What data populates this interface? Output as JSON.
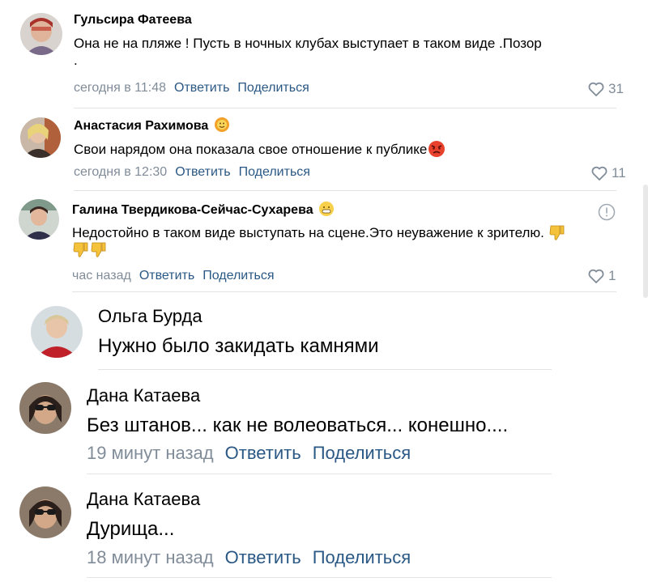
{
  "comments": [
    {
      "author": "Гульсира Фатеева",
      "text": "Она не на пляже ! Пусть в ночных клубах выступает в таком виде .Позор",
      "text_tail": ".",
      "time": "сегодня в 11:48",
      "reply": "Ответить",
      "share": "Поделиться",
      "likes": "31",
      "avatar_icon": "user-photo"
    },
    {
      "author": "Анастасия Рахимова",
      "author_badge": "smiley-icon",
      "text": "Свои нарядом она показала свое отношение к публике",
      "text_emoji": "angry-face",
      "time": "сегодня в 12:30",
      "reply": "Ответить",
      "share": "Поделиться",
      "likes": "11",
      "avatar_icon": "user-photo"
    },
    {
      "author": "Галина Твердикова-Сейчас-Сухарева",
      "author_badge": "grimace-face",
      "text": "Недостойно в таком виде выступать на сцене.Это неуважение к зрителю.",
      "text_emoji": "thumbs-down x3",
      "time": "час назад",
      "reply": "Ответить",
      "share": "Поделиться",
      "likes": "1",
      "avatar_icon": "user-photo",
      "report_icon": "exclamation-circle-icon"
    },
    {
      "author": "Ольга Бурда",
      "text": "Нужно было закидать камнями",
      "avatar_icon": "user-photo"
    },
    {
      "author": "Дана Катаева",
      "text": "Без штанов... как не волеоваться... конешно....",
      "time": "19 минут назад",
      "reply": "Ответить",
      "share": "Поделиться",
      "avatar_icon": "user-photo"
    },
    {
      "author": "Дана Катаева",
      "text": "Дурища...",
      "time": "18 минут назад",
      "reply": "Ответить",
      "share": "Поделиться",
      "avatar_icon": "user-photo"
    }
  ],
  "colors": {
    "link": "#2a5885",
    "meta": "#818c99",
    "divider": "#e1e3e6"
  }
}
